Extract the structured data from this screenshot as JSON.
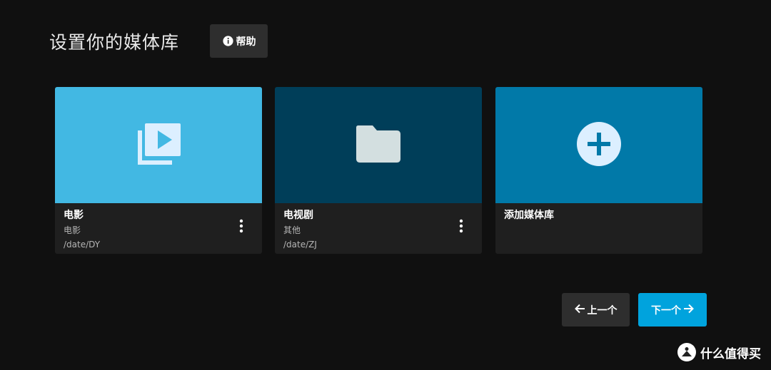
{
  "header": {
    "title": "设置你的媒体库",
    "help_label": "帮助"
  },
  "libraries": [
    {
      "name": "电影",
      "type": "电影",
      "path": "/date/DY",
      "icon": "movie-library-icon",
      "color": "#42b8e3"
    },
    {
      "name": "电视剧",
      "type": "其他",
      "path": "/date/ZJ",
      "icon": "folder-icon",
      "color": "#003e59"
    }
  ],
  "add_card": {
    "label": "添加媒体库",
    "icon": "add-circle-icon",
    "color": "#0179a8"
  },
  "navigation": {
    "prev_label": "上一个",
    "next_label": "下一个"
  },
  "watermark": {
    "text": "什么值得买"
  }
}
